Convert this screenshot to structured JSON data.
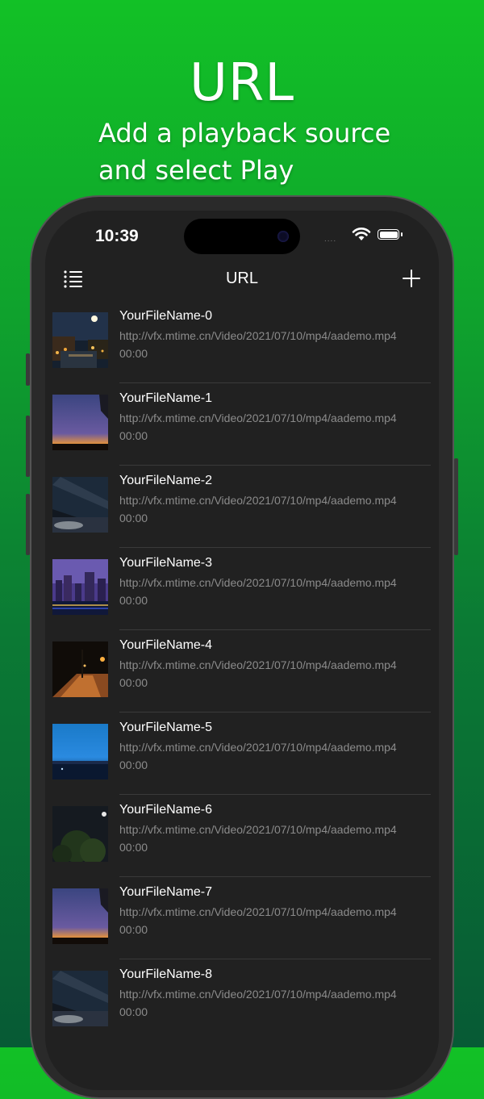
{
  "promo": {
    "title": "URL",
    "subtitle_line1": "Add a playback source",
    "subtitle_line2": "and select Play"
  },
  "status_bar": {
    "time": "10:39",
    "signal": "....",
    "wifi_icon": "wifi-icon",
    "battery_icon": "battery-icon"
  },
  "nav": {
    "title": "URL",
    "menu_icon": "list-icon",
    "add_icon": "plus-icon"
  },
  "items": [
    {
      "name": "YourFileName-0",
      "url": "http://vfx.mtime.cn/Video/2021/07/10/mp4/aademo.mp4",
      "duration": "00:00"
    },
    {
      "name": "YourFileName-1",
      "url": "http://vfx.mtime.cn/Video/2021/07/10/mp4/aademo.mp4",
      "duration": "00:00"
    },
    {
      "name": "YourFileName-2",
      "url": "http://vfx.mtime.cn/Video/2021/07/10/mp4/aademo.mp4",
      "duration": "00:00"
    },
    {
      "name": "YourFileName-3",
      "url": "http://vfx.mtime.cn/Video/2021/07/10/mp4/aademo.mp4",
      "duration": "00:00"
    },
    {
      "name": "YourFileName-4",
      "url": "http://vfx.mtime.cn/Video/2021/07/10/mp4/aademo.mp4",
      "duration": "00:00"
    },
    {
      "name": "YourFileName-5",
      "url": "http://vfx.mtime.cn/Video/2021/07/10/mp4/aademo.mp4",
      "duration": "00:00"
    },
    {
      "name": "YourFileName-6",
      "url": "http://vfx.mtime.cn/Video/2021/07/10/mp4/aademo.mp4",
      "duration": "00:00"
    },
    {
      "name": "YourFileName-7",
      "url": "http://vfx.mtime.cn/Video/2021/07/10/mp4/aademo.mp4",
      "duration": "00:00"
    },
    {
      "name": "YourFileName-8",
      "url": "http://vfx.mtime.cn/Video/2021/07/10/mp4/aademo.mp4",
      "duration": "00:00"
    }
  ],
  "colors": {
    "background_top": "#12c126",
    "background_bottom": "#075a35",
    "screen": "#212121",
    "secondary_text": "#8b8b8b"
  }
}
